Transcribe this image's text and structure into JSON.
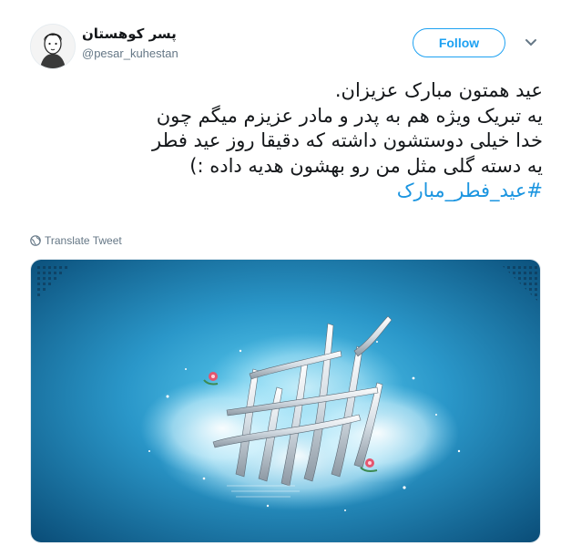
{
  "user": {
    "display_name": "پسر کوهستان",
    "handle": "@pesar_kuhestan"
  },
  "actions": {
    "follow_label": "Follow",
    "more_icon": "chevron-down-icon"
  },
  "tweet": {
    "lines": [
      "عید همتون مبارک عزیزان.",
      "یه تبریک ویژه هم به پدر و مادر عزیزم میگم چون",
      "خدا خیلی دوستشون داشته که دقیقا روز عید فطر",
      "یه دسته گلی مثل من رو بهشون هدیه داده :)"
    ],
    "hashtag": "#عید_فطر_مبارک"
  },
  "translate": {
    "label": "Translate Tweet",
    "icon": "globe-icon"
  },
  "media": {
    "description_icon": "calligraphy-image",
    "colors": {
      "background_dark": "#0a5c8c",
      "background_light": "#3fb3dc",
      "glow": "#bfefff"
    }
  },
  "colors": {
    "accent": "#1da1f2",
    "hashtag": "#1b95e0",
    "secondary_text": "#657786"
  }
}
